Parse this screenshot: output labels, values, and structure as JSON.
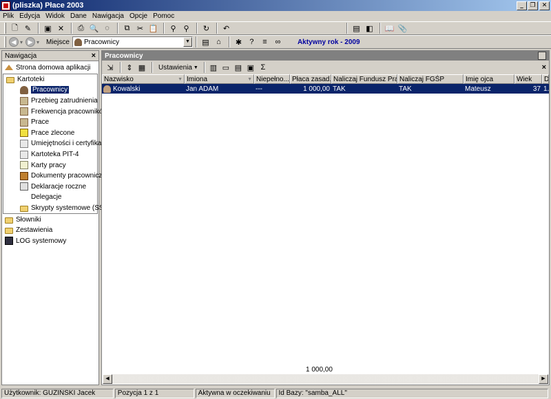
{
  "window": {
    "title": "(pliszka) Płace 2003"
  },
  "menu": [
    "Plik",
    "Edycja",
    "Widok",
    "Dane",
    "Nawigacja",
    "Opcje",
    "Pomoc"
  ],
  "toolbar2": {
    "place_label": "Miejsce",
    "place_value": "Pracownicy",
    "active_year": "Aktywny rok - 2009"
  },
  "nav": {
    "title": "Nawigacja",
    "close": "×",
    "items": [
      {
        "label": "Strona domowa aplikacji",
        "level": 1,
        "icon": "home-icon"
      },
      {
        "label": "Kartoteki",
        "level": 1,
        "icon": "folder-icon"
      },
      {
        "label": "Pracownicy",
        "level": 2,
        "icon": "employees-icon",
        "selected": true
      },
      {
        "label": "Przebieg zatrudnienia",
        "level": 2,
        "icon": "employment-history-icon"
      },
      {
        "label": "Frekwencja pracowników",
        "level": 2,
        "icon": "attendance-icon"
      },
      {
        "label": "Prace",
        "level": 2,
        "icon": "work-icon"
      },
      {
        "label": "Prace zlecone",
        "level": 2,
        "icon": "commissioned-work-icon"
      },
      {
        "label": "Umiejętności i certyfikaty",
        "level": 2,
        "icon": "certificate-icon"
      },
      {
        "label": "Kartoteka PIT-4",
        "level": 2,
        "icon": "pit4-icon"
      },
      {
        "label": "Karty pracy",
        "level": 2,
        "icon": "work-card-icon"
      },
      {
        "label": "Dokumenty pracownicze",
        "level": 2,
        "icon": "documents-icon"
      },
      {
        "label": "Deklaracje roczne",
        "level": 2,
        "icon": "declarations-icon"
      },
      {
        "label": "Delegacje",
        "level": 2,
        "icon": ""
      },
      {
        "label": "Skrypty systemowe (SSH)",
        "level": 2,
        "icon": "folder-icon"
      },
      {
        "label": "Słowniki",
        "level": 1,
        "icon": "folder-icon"
      },
      {
        "label": "Zestawienia",
        "level": 1,
        "icon": "folder-icon"
      },
      {
        "label": "LOG systemowy",
        "level": 1,
        "icon": "log-icon"
      }
    ]
  },
  "main": {
    "title": "Pracownicy",
    "settings_label": "Ustawienia",
    "sigma": "Σ",
    "columns": [
      {
        "label": "Nazwisko",
        "filter": true
      },
      {
        "label": "Imiona",
        "filter": true
      },
      {
        "label": "Niepełno...",
        "filter": false
      },
      {
        "label": "Płaca zasad.",
        "filter": false
      },
      {
        "label": "Naliczaj Fundusz Pracy",
        "filter": false
      },
      {
        "label": "Naliczaj FGŚP",
        "filter": false
      },
      {
        "label": "Imię ojca",
        "filter": false
      },
      {
        "label": "Wiek",
        "filter": false
      },
      {
        "label": "D",
        "filter": false
      }
    ],
    "rows": [
      [
        "Kowalski",
        "Jan ADAM",
        "---",
        "1 000,00",
        "TAK",
        "TAK",
        "Mateusz",
        "37",
        "1..."
      ]
    ],
    "footer_sum": "1 000,00"
  },
  "status": {
    "user": "Użytkownik: GUZIŃSKI Jacek",
    "position": "Pozycja 1 z 1",
    "state": "Aktywna w oczekiwaniu",
    "db": "Id Bazy: \"samba_ALL\""
  }
}
